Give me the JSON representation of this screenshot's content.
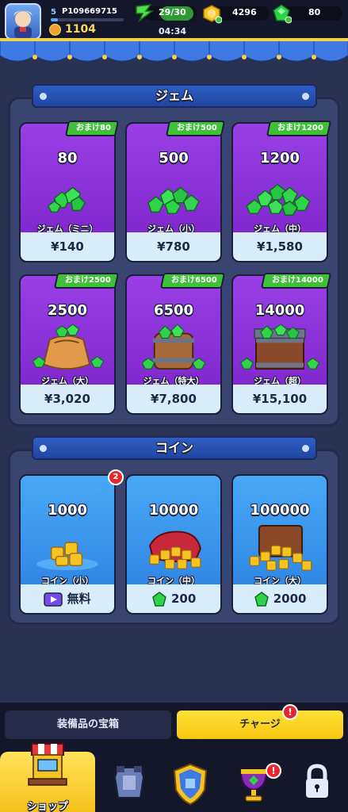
{
  "header": {
    "level": "5",
    "player_id": "P109669715",
    "xp_progress": 0.1,
    "power": "1104",
    "energy": "29/30",
    "gold": "4296",
    "gems": "80",
    "timer": "04:34"
  },
  "gem_section": {
    "title": "ジェム",
    "items": [
      {
        "bonus": "おまけ80",
        "amount": "80",
        "name": "ジェム（ミニ）",
        "price": "¥140"
      },
      {
        "bonus": "おまけ500",
        "amount": "500",
        "name": "ジェム（小）",
        "price": "¥780"
      },
      {
        "bonus": "おまけ1200",
        "amount": "1200",
        "name": "ジェム（中）",
        "price": "¥1,580"
      },
      {
        "bonus": "おまけ2500",
        "amount": "2500",
        "name": "ジェム（大）",
        "price": "¥3,020"
      },
      {
        "bonus": "おまけ6500",
        "amount": "6500",
        "name": "ジェム（特大）",
        "price": "¥7,800"
      },
      {
        "bonus": "おまけ14000",
        "amount": "14000",
        "name": "ジェム（超）",
        "price": "¥15,100"
      }
    ]
  },
  "coin_section": {
    "title": "コイン",
    "items": [
      {
        "amount": "1000",
        "name": "コイン（小）",
        "price": "無料",
        "badge": "2"
      },
      {
        "amount": "10000",
        "name": "コイン（中）",
        "price": "200"
      },
      {
        "amount": "100000",
        "name": "コイン（大）",
        "price": "2000"
      }
    ]
  },
  "buttons": {
    "equipment_chest": "装備品の宝箱",
    "charge": "チャージ",
    "alert": "!"
  },
  "nav": {
    "shop": "ショップ",
    "alert": "!"
  },
  "colors": {
    "gem_card": "#8a30d8",
    "coin_card": "#3a94ec",
    "bonus_tag": "#3fbf3a",
    "price_bar": "#d8ecfa",
    "charge_button": "#f7c511"
  }
}
